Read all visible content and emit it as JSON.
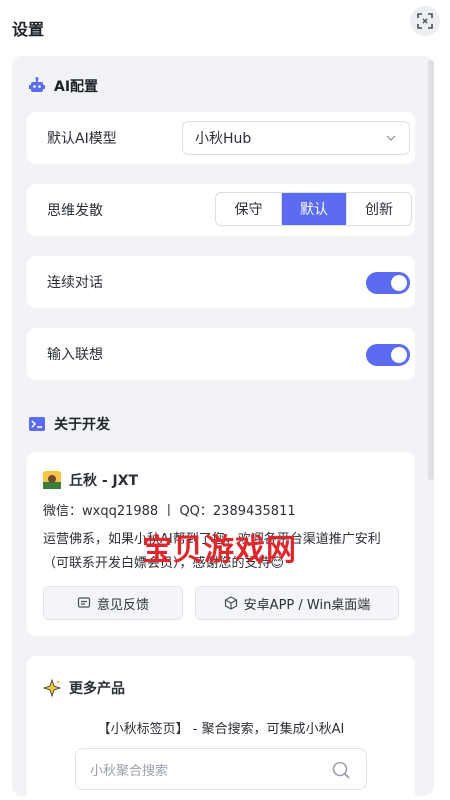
{
  "title": "设置",
  "ai_section": {
    "title": "AI配置",
    "model": {
      "label": "默认AI模型",
      "value": "小秋Hub"
    },
    "thinking": {
      "label": "思维发散",
      "options": [
        "保守",
        "默认",
        "创新"
      ],
      "selected": "默认"
    },
    "continuous": {
      "label": "连续对话",
      "enabled": true
    },
    "suggest": {
      "label": "输入联想",
      "enabled": true
    }
  },
  "dev_section": {
    "title": "关于开发",
    "name": "丘秋 - JXT",
    "contact": "微信：wxqq21988 丨 QQ：2389435811",
    "description": "运营佛系，如果小秋AI帮到了您，欢迎各平台渠道推广安利（可联系开发白嫖会员），感谢您的支持😊",
    "feedback_label": "意见反馈",
    "download_label": "安卓APP / Win桌面端"
  },
  "watermark": "宝贝游戏网",
  "more_section": {
    "title": "更多产品",
    "description": "【小秋标签页】 - 聚合搜索，可集成小秋AI",
    "search_placeholder": "小秋聚合搜索"
  },
  "colors": {
    "accent": "#5b6cf3",
    "panel": "#f2f3f7",
    "watermark": "#e0262b"
  }
}
